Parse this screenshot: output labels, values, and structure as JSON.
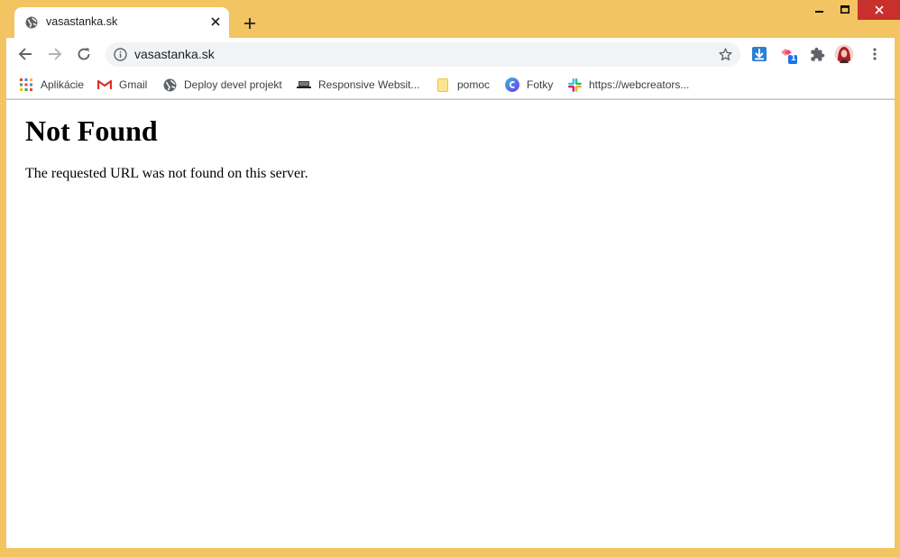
{
  "tab": {
    "title": "vasastanka.sk",
    "favicon": "globe-icon"
  },
  "address_bar": {
    "url": "vasastanka.sk"
  },
  "bookmarks": [
    {
      "label": "Aplikácie",
      "icon": "apps-grid-icon"
    },
    {
      "label": "Gmail",
      "icon": "gmail-icon"
    },
    {
      "label": "Deploy devel projekt",
      "icon": "globe-icon"
    },
    {
      "label": "Responsive Websit...",
      "icon": "devices-icon"
    },
    {
      "label": "pomoc",
      "icon": "folder-icon"
    },
    {
      "label": "Fotky",
      "icon": "canva-icon"
    },
    {
      "label": "https://webcreators...",
      "icon": "slack-icon"
    }
  ],
  "page": {
    "heading": "Not Found",
    "message": "The requested URL was not found on this server."
  },
  "extensions": {
    "badge_count": "1"
  },
  "colors": {
    "frame": "#f2c462",
    "close_button": "#c9302c",
    "download_icon": "#2b7fd4"
  }
}
